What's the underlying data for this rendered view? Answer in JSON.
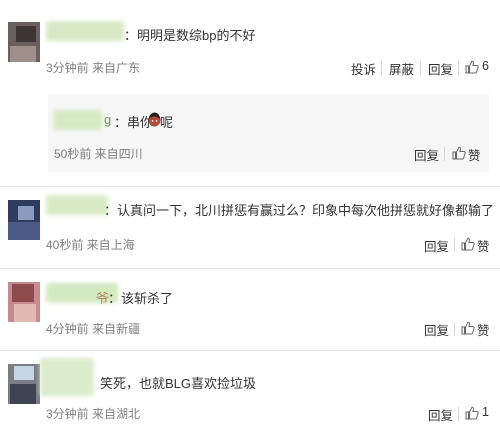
{
  "comments": [
    {
      "text": "：明明是数综bp的不好",
      "meta": "3分钟前 来自广东",
      "actions": {
        "report": "投诉",
        "block": "屏蔽",
        "reply": "回复",
        "like": "6"
      }
    },
    {
      "name_tail": "g",
      "text": "：串你 ",
      "text_tail": "呢",
      "meta": "50秒前 来自四川",
      "actions": {
        "reply": "回复",
        "like": "赞"
      }
    },
    {
      "text": "：认真问一下，北川拼惩有赢过么？印象中每次他拼惩就好像都输了",
      "meta": "40秒前 来自上海",
      "actions": {
        "reply": "回复",
        "like": "赞"
      }
    },
    {
      "name_tail": "爷",
      "text": "：该斩杀了",
      "meta": "4分钟前 来自新疆",
      "actions": {
        "reply": "回复",
        "like": "赞"
      }
    },
    {
      "text": "笑死，也就BLG喜欢捡垃圾",
      "meta": "3分钟前 来自湖北",
      "actions": {
        "reply": "回复",
        "like": "1"
      }
    }
  ],
  "icons": {
    "like": "thumbs-up-icon",
    "emoji": "flushed-face-emoji"
  },
  "colors": {
    "text": "#333333",
    "meta": "#808080",
    "reply_bg": "#f6f6f6",
    "divider": "#e8e8e8"
  }
}
